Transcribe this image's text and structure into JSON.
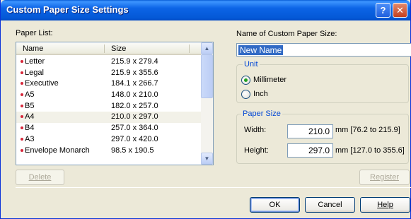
{
  "window": {
    "title": "Custom Paper Size Settings"
  },
  "titlebar": {
    "help_glyph": "?",
    "close_glyph": "✕"
  },
  "paper_list": {
    "label": "Paper List:",
    "columns": [
      "Name",
      "Size"
    ],
    "rows": [
      {
        "name": "Letter",
        "size": "215.9 x 279.4"
      },
      {
        "name": "Legal",
        "size": "215.9 x 355.6"
      },
      {
        "name": "Executive",
        "size": "184.1 x 266.7"
      },
      {
        "name": "A5",
        "size": "148.0 x 210.0"
      },
      {
        "name": "B5",
        "size": "182.0 x 257.0"
      },
      {
        "name": "A4",
        "size": "210.0 x 297.0"
      },
      {
        "name": "B4",
        "size": "257.0 x 364.0"
      },
      {
        "name": "A3",
        "size": "297.0 x 420.0"
      },
      {
        "name": "Envelope Monarch",
        "size": "98.5 x 190.5"
      }
    ],
    "selected": "A4",
    "delete_label": "Delete"
  },
  "custom_name": {
    "label": "Name of Custom Paper Size:",
    "value": "New Name"
  },
  "unit": {
    "legend": "Unit",
    "options": [
      "Millimeter",
      "Inch"
    ],
    "selected": "Millimeter"
  },
  "paper_size": {
    "legend": "Paper Size",
    "width_label": "Width:",
    "width_value": "210.0",
    "width_range": "mm [76.2 to 215.9]",
    "height_label": "Height:",
    "height_value": "297.0",
    "height_range": "mm [127.0 to 355.6]"
  },
  "buttons": {
    "register": "Register",
    "ok": "OK",
    "cancel": "Cancel",
    "help": "Help"
  },
  "colors": {
    "titlebar": "#0458d6",
    "selection": "#316ac5",
    "bullet": "#d6273a"
  }
}
